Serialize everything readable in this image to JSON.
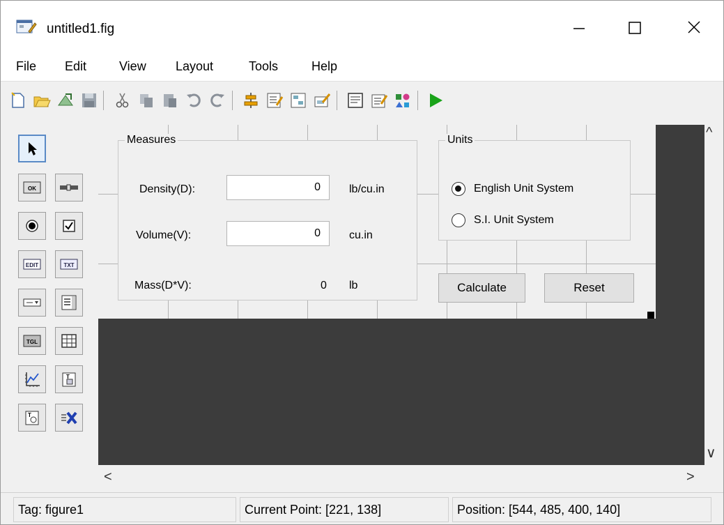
{
  "window": {
    "title": "untitled1.fig"
  },
  "menu": [
    "File",
    "Edit",
    "View",
    "Layout",
    "Tools",
    "Help"
  ],
  "toolbar": {
    "icons": [
      "new-icon",
      "open-icon",
      "export-icon",
      "save-icon",
      "cut-icon",
      "copy-icon",
      "paste-icon",
      "undo-icon",
      "redo-icon",
      "align-icon",
      "menu-editor-icon",
      "tab-order-icon",
      "toolbar-editor-icon",
      "editor-icon",
      "property-inspector-icon",
      "object-browser-icon",
      "run-icon"
    ]
  },
  "palette": {
    "items": [
      "select-tool",
      "push-button",
      "slider",
      "radio-button",
      "check-box",
      "edit-text",
      "static-text",
      "pop-up-menu",
      "list-box",
      "toggle-button",
      "table",
      "axes",
      "panel",
      "button-group",
      "activex-control"
    ],
    "glyphs": {
      "push": "OK",
      "edit": "EDIT",
      "text": "TXT",
      "toggle": "TGL"
    }
  },
  "figure": {
    "measures_panel": {
      "title": "Measures",
      "density_label": "Density(D):",
      "density_value": "0",
      "density_unit": "lb/cu.in",
      "volume_label": "Volume(V):",
      "volume_value": "0",
      "volume_unit": "cu.in",
      "mass_label": "Mass(D*V):",
      "mass_value": "0",
      "mass_unit": "lb"
    },
    "units_panel": {
      "title": "Units",
      "option_english": "English Unit System",
      "option_si": "S.I. Unit System",
      "selected": "English Unit System"
    },
    "calculate_label": "Calculate",
    "reset_label": "Reset"
  },
  "status": {
    "tag": "Tag: figure1",
    "current_point": "Current Point:  [221, 138]",
    "position": "Position: [544, 485, 400, 140]"
  },
  "colors": {
    "run_green": "#1aa31a",
    "canvas_bg": "#3c3c3c",
    "select_blue": "#5a8ac6"
  }
}
